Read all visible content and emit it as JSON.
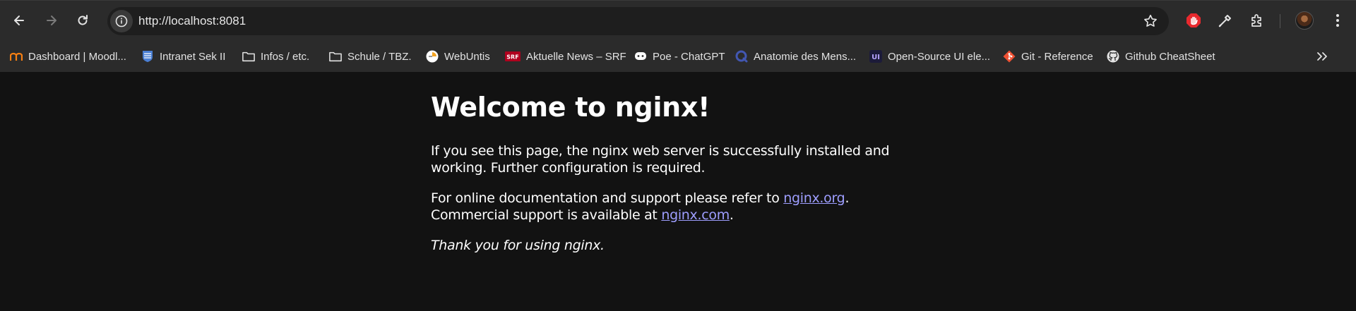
{
  "browser": {
    "url": "http://localhost:8081",
    "bookmarks": [
      {
        "label": "Dashboard | Moodl...",
        "icon": "moodle-icon"
      },
      {
        "label": "Intranet Sek II",
        "icon": "school-crest-icon"
      },
      {
        "label": "Infos / etc.",
        "icon": "folder-icon"
      },
      {
        "label": "Schule / TBZ.",
        "icon": "folder-icon"
      },
      {
        "label": "WebUntis",
        "icon": "webuntis-icon"
      },
      {
        "label": "Aktuelle News – SRF",
        "icon": "srf-icon"
      },
      {
        "label": "Poe - ChatGPT",
        "icon": "poe-icon"
      },
      {
        "label": "Anatomie des Mens...",
        "icon": "quizlet-icon"
      },
      {
        "label": "Open-Source UI ele...",
        "icon": "ui-icon"
      },
      {
        "label": "Git - Reference",
        "icon": "git-icon"
      },
      {
        "label": "Github CheatSheet",
        "icon": "github-icon"
      }
    ]
  },
  "page": {
    "title": "Welcome to nginx!",
    "para1": "If you see this page, the nginx web server is successfully installed and working. Further configuration is required.",
    "para2_before": "For online documentation and support please refer to ",
    "link1": "nginx.org",
    "para2_mid_end": ".",
    "para2_line2": "Commercial support is available at ",
    "link2": "nginx.com",
    "para2_end": ".",
    "thanks": "Thank you for using nginx."
  },
  "colors": {
    "toolbar_bg": "#2b2b2b",
    "page_bg": "#121212",
    "link": "#9e9eff"
  }
}
